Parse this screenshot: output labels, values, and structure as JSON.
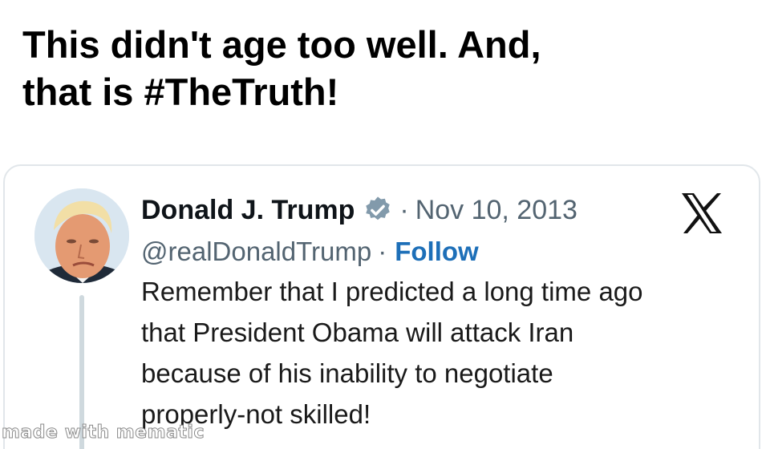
{
  "meme": {
    "caption_lines": [
      "This didn't age too well. And,",
      "that is #TheTruth!"
    ],
    "watermark": "made with mematic"
  },
  "tweet": {
    "display_name": "Donald J. Trump",
    "separator": "·",
    "date": "Nov 10, 2013",
    "handle": "@realDonaldTrump",
    "follow_label": "Follow",
    "text_lines": [
      "Remember that I predicted a long time ago",
      "that President Obama will attack Iran",
      "because of his inability to negotiate",
      "properly-not skilled!"
    ],
    "verified_icon": "verified-badge-icon",
    "platform_icon": "x-logo-icon"
  },
  "colors": {
    "text": "#0f1419",
    "muted": "#536471",
    "link": "#1d6fb8",
    "verified": "#829aab",
    "border": "#e1e6ea"
  }
}
